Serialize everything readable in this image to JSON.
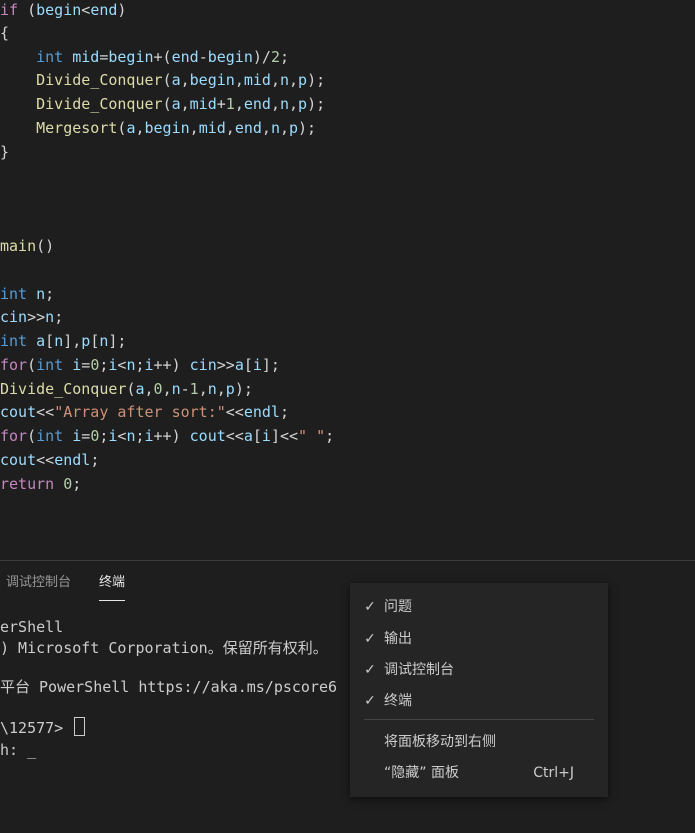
{
  "editor": {
    "lines": [
      [
        {
          "t": "if",
          "c": "kw"
        },
        {
          "t": " (",
          "c": "plain"
        },
        {
          "t": "begin",
          "c": "var"
        },
        {
          "t": "<",
          "c": "plain"
        },
        {
          "t": "end",
          "c": "var"
        },
        {
          "t": ")",
          "c": "plain"
        }
      ],
      [
        {
          "t": "{",
          "c": "plain"
        }
      ],
      [
        {
          "t": "    ",
          "c": "plain"
        },
        {
          "t": "int",
          "c": "ty"
        },
        {
          "t": " ",
          "c": "plain"
        },
        {
          "t": "mid",
          "c": "var"
        },
        {
          "t": "=",
          "c": "plain"
        },
        {
          "t": "begin",
          "c": "var"
        },
        {
          "t": "+(",
          "c": "plain"
        },
        {
          "t": "end",
          "c": "var"
        },
        {
          "t": "-",
          "c": "plain"
        },
        {
          "t": "begin",
          "c": "var"
        },
        {
          "t": ")/",
          "c": "plain"
        },
        {
          "t": "2",
          "c": "num"
        },
        {
          "t": ";",
          "c": "plain"
        }
      ],
      [
        {
          "t": "    ",
          "c": "plain"
        },
        {
          "t": "Divide_Conquer",
          "c": "fn"
        },
        {
          "t": "(",
          "c": "plain"
        },
        {
          "t": "a",
          "c": "var"
        },
        {
          "t": ",",
          "c": "plain"
        },
        {
          "t": "begin",
          "c": "var"
        },
        {
          "t": ",",
          "c": "plain"
        },
        {
          "t": "mid",
          "c": "var"
        },
        {
          "t": ",",
          "c": "plain"
        },
        {
          "t": "n",
          "c": "var"
        },
        {
          "t": ",",
          "c": "plain"
        },
        {
          "t": "p",
          "c": "var"
        },
        {
          "t": ");",
          "c": "plain"
        }
      ],
      [
        {
          "t": "    ",
          "c": "plain"
        },
        {
          "t": "Divide_Conquer",
          "c": "fn"
        },
        {
          "t": "(",
          "c": "plain"
        },
        {
          "t": "a",
          "c": "var"
        },
        {
          "t": ",",
          "c": "plain"
        },
        {
          "t": "mid",
          "c": "var"
        },
        {
          "t": "+",
          "c": "plain"
        },
        {
          "t": "1",
          "c": "num"
        },
        {
          "t": ",",
          "c": "plain"
        },
        {
          "t": "end",
          "c": "var"
        },
        {
          "t": ",",
          "c": "plain"
        },
        {
          "t": "n",
          "c": "var"
        },
        {
          "t": ",",
          "c": "plain"
        },
        {
          "t": "p",
          "c": "var"
        },
        {
          "t": ");",
          "c": "plain"
        }
      ],
      [
        {
          "t": "    ",
          "c": "plain"
        },
        {
          "t": "Mergesort",
          "c": "fn"
        },
        {
          "t": "(",
          "c": "plain"
        },
        {
          "t": "a",
          "c": "var"
        },
        {
          "t": ",",
          "c": "plain"
        },
        {
          "t": "begin",
          "c": "var"
        },
        {
          "t": ",",
          "c": "plain"
        },
        {
          "t": "mid",
          "c": "var"
        },
        {
          "t": ",",
          "c": "plain"
        },
        {
          "t": "end",
          "c": "var"
        },
        {
          "t": ",",
          "c": "plain"
        },
        {
          "t": "n",
          "c": "var"
        },
        {
          "t": ",",
          "c": "plain"
        },
        {
          "t": "p",
          "c": "var"
        },
        {
          "t": ");",
          "c": "plain"
        }
      ],
      [
        {
          "t": "}",
          "c": "plain"
        }
      ],
      [],
      [],
      [],
      [
        {
          "t": "main",
          "c": "fn"
        },
        {
          "t": "()",
          "c": "plain"
        }
      ],
      [],
      [
        {
          "t": "int",
          "c": "ty"
        },
        {
          "t": " ",
          "c": "plain"
        },
        {
          "t": "n",
          "c": "var"
        },
        {
          "t": ";",
          "c": "plain"
        }
      ],
      [
        {
          "t": "cin",
          "c": "var"
        },
        {
          "t": ">>",
          "c": "plain"
        },
        {
          "t": "n",
          "c": "var"
        },
        {
          "t": ";",
          "c": "plain"
        }
      ],
      [
        {
          "t": "int",
          "c": "ty"
        },
        {
          "t": " ",
          "c": "plain"
        },
        {
          "t": "a",
          "c": "var"
        },
        {
          "t": "[",
          "c": "plain"
        },
        {
          "t": "n",
          "c": "var"
        },
        {
          "t": "],",
          "c": "plain"
        },
        {
          "t": "p",
          "c": "var"
        },
        {
          "t": "[",
          "c": "plain"
        },
        {
          "t": "n",
          "c": "var"
        },
        {
          "t": "];",
          "c": "plain"
        }
      ],
      [
        {
          "t": "for",
          "c": "kw"
        },
        {
          "t": "(",
          "c": "plain"
        },
        {
          "t": "int",
          "c": "ty"
        },
        {
          "t": " ",
          "c": "plain"
        },
        {
          "t": "i",
          "c": "var"
        },
        {
          "t": "=",
          "c": "plain"
        },
        {
          "t": "0",
          "c": "num"
        },
        {
          "t": ";",
          "c": "plain"
        },
        {
          "t": "i",
          "c": "var"
        },
        {
          "t": "<",
          "c": "plain"
        },
        {
          "t": "n",
          "c": "var"
        },
        {
          "t": ";",
          "c": "plain"
        },
        {
          "t": "i",
          "c": "var"
        },
        {
          "t": "++) ",
          "c": "plain"
        },
        {
          "t": "cin",
          "c": "var"
        },
        {
          "t": ">>",
          "c": "plain"
        },
        {
          "t": "a",
          "c": "var"
        },
        {
          "t": "[",
          "c": "plain"
        },
        {
          "t": "i",
          "c": "var"
        },
        {
          "t": "];",
          "c": "plain"
        }
      ],
      [
        {
          "t": "Divide_Conquer",
          "c": "fn"
        },
        {
          "t": "(",
          "c": "plain"
        },
        {
          "t": "a",
          "c": "var"
        },
        {
          "t": ",",
          "c": "plain"
        },
        {
          "t": "0",
          "c": "num"
        },
        {
          "t": ",",
          "c": "plain"
        },
        {
          "t": "n",
          "c": "var"
        },
        {
          "t": "-",
          "c": "plain"
        },
        {
          "t": "1",
          "c": "num"
        },
        {
          "t": ",",
          "c": "plain"
        },
        {
          "t": "n",
          "c": "var"
        },
        {
          "t": ",",
          "c": "plain"
        },
        {
          "t": "p",
          "c": "var"
        },
        {
          "t": ");",
          "c": "plain"
        }
      ],
      [
        {
          "t": "cout",
          "c": "var"
        },
        {
          "t": "<<",
          "c": "plain"
        },
        {
          "t": "\"Array after sort:\"",
          "c": "str"
        },
        {
          "t": "<<",
          "c": "plain"
        },
        {
          "t": "endl",
          "c": "var"
        },
        {
          "t": ";",
          "c": "plain"
        }
      ],
      [
        {
          "t": "for",
          "c": "kw"
        },
        {
          "t": "(",
          "c": "plain"
        },
        {
          "t": "int",
          "c": "ty"
        },
        {
          "t": " ",
          "c": "plain"
        },
        {
          "t": "i",
          "c": "var"
        },
        {
          "t": "=",
          "c": "plain"
        },
        {
          "t": "0",
          "c": "num"
        },
        {
          "t": ";",
          "c": "plain"
        },
        {
          "t": "i",
          "c": "var"
        },
        {
          "t": "<",
          "c": "plain"
        },
        {
          "t": "n",
          "c": "var"
        },
        {
          "t": ";",
          "c": "plain"
        },
        {
          "t": "i",
          "c": "var"
        },
        {
          "t": "++) ",
          "c": "plain"
        },
        {
          "t": "cout",
          "c": "var"
        },
        {
          "t": "<<",
          "c": "plain"
        },
        {
          "t": "a",
          "c": "var"
        },
        {
          "t": "[",
          "c": "plain"
        },
        {
          "t": "i",
          "c": "var"
        },
        {
          "t": "]<<",
          "c": "plain"
        },
        {
          "t": "\" \"",
          "c": "str"
        },
        {
          "t": ";",
          "c": "plain"
        }
      ],
      [
        {
          "t": "cout",
          "c": "var"
        },
        {
          "t": "<<",
          "c": "plain"
        },
        {
          "t": "endl",
          "c": "var"
        },
        {
          "t": ";",
          "c": "plain"
        }
      ],
      [
        {
          "t": "return",
          "c": "kw"
        },
        {
          "t": " ",
          "c": "plain"
        },
        {
          "t": "0",
          "c": "num"
        },
        {
          "t": ";",
          "c": "plain"
        }
      ]
    ]
  },
  "panel": {
    "tabs": {
      "debug_console": "调试控制台",
      "terminal": "终端"
    },
    "terminal": {
      "line1": "erShell",
      "line2": ") Microsoft Corporation。保留所有权利。",
      "line3": "平台 PowerShell https://aka.ms/pscore6",
      "line4_prompt": "\\12577> ",
      "line5": "h: _"
    }
  },
  "context_menu": {
    "items": {
      "problems": {
        "check": "✓",
        "label": "问题"
      },
      "output": {
        "check": "✓",
        "label": "输出"
      },
      "debug_console": {
        "check": "✓",
        "label": "调试控制台"
      },
      "terminal": {
        "check": "✓",
        "label": "终端"
      },
      "move_panel_right": {
        "label": "将面板移动到右侧"
      },
      "hide_panel": {
        "label": "“隐藏” 面板",
        "shortcut": "Ctrl+J"
      }
    }
  },
  "colors": {
    "editor_bg": "#1e1e1e",
    "keyword": "#c586c0",
    "type": "#569cd6",
    "function": "#dcdcaa",
    "variable": "#9cdcfe",
    "number": "#b5cea8",
    "string": "#ce9178",
    "menu_bg": "#252526"
  }
}
